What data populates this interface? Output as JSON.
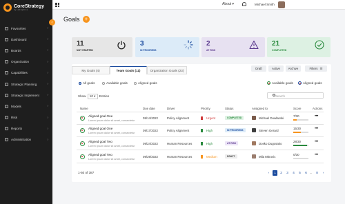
{
  "app": {
    "logo_name": "CoreStrategy",
    "logo_sub": "by adaptive"
  },
  "sidebar": {
    "items": [
      {
        "label": "Favourites"
      },
      {
        "label": "Dashboard"
      },
      {
        "label": "Boards"
      },
      {
        "label": "Organization"
      },
      {
        "label": "Capabilities"
      },
      {
        "label": "Strategic Planning"
      },
      {
        "label": "Strategic Implement"
      },
      {
        "label": "Models"
      },
      {
        "label": "Risk"
      },
      {
        "label": "Reports"
      },
      {
        "label": "Administration"
      }
    ]
  },
  "topbar": {
    "about": "About ▾",
    "user": "Michael Smith"
  },
  "page": {
    "title": "Goals",
    "add_label": "+"
  },
  "stats": [
    {
      "value": "11",
      "label": "NOT STARTED",
      "icon": "power-icon",
      "bg": "#e6e6e6",
      "color": "#222222"
    },
    {
      "value": "3",
      "label": "IN PROGRESS",
      "icon": "spinner-icon",
      "bg": "#dcebf8",
      "color": "#1a4a9e"
    },
    {
      "value": "2",
      "label": "AT RISK",
      "icon": "warning-icon",
      "bg": "#e7e1f1",
      "color": "#5b3a8e"
    },
    {
      "value": "21",
      "label": "COMPLETED",
      "icon": "check-circle-icon",
      "bg": "#ddf1e3",
      "color": "#2a8a3e"
    }
  ],
  "tabs": {
    "my": "My Goals (4)",
    "team": "Team Goals (11)",
    "org": "Organization Goals (23)"
  },
  "filters": {
    "draft": "Draft",
    "active": "Active",
    "archive": "Archive",
    "filters": "Filters"
  },
  "radios": {
    "all": "All goals",
    "available": "Available goals",
    "aligned": "Aligned goals"
  },
  "legend": {
    "available": "Available goals",
    "aligned": "Aligned goals"
  },
  "entries": {
    "show": "Show",
    "count": "10",
    "suffix": "Entries"
  },
  "search": {
    "placeholder": "Search"
  },
  "table": {
    "headers": {
      "name": "Name",
      "due": "Due date",
      "driver": "Driver",
      "priority": "Priority",
      "status": "Status",
      "assigned": "Assigned to",
      "score": "Score",
      "actions": "Actions"
    },
    "rows": [
      {
        "title": "Aligned goal One",
        "sub": "Lorem ipsum dolor sit amet, consectetur",
        "due": "09/14/2022",
        "driver": "Policy Alignment",
        "priority": "Urgent",
        "prio_color": "#d03b3b",
        "status": "COMPLETED",
        "status_bg": "#dff2e4",
        "status_color": "#2a8a3e",
        "assignee": "Michael Dowlanski",
        "score": "7/30",
        "fill": 0.23,
        "bar_color": "#f7941d",
        "av": "#7a5b4a"
      },
      {
        "title": "Aligned goal One",
        "sub": "Lorem ipsum dolor sit amet, consectetur",
        "due": "09/17/2022",
        "driver": "Policy Alignment",
        "priority": "High",
        "prio_color": "#2a8a3e",
        "status": "IN PROGRESS",
        "status_bg": "#dcebf8",
        "status_color": "#1a4a9e",
        "assignee": "Steven Gerard",
        "score": "15/30",
        "fill": 0.5,
        "bar_color": "#f7941d",
        "av": "#3e3e3e"
      },
      {
        "title": "Aligned goal Two",
        "sub": "Lorem ipsum dolor sit amet, consectetur",
        "due": "09/24/2022",
        "driver": "Human Resources",
        "priority": "High",
        "prio_color": "#2a8a3e",
        "status": "AT RISK",
        "status_bg": "#ece4f7",
        "status_color": "#5b3a8e",
        "assignee": "Dosko Dugosako",
        "score": "28/30",
        "fill": 0.93,
        "bar_color": "#2a8a3e",
        "av": "#a07860"
      },
      {
        "title": "Aligned goal Two",
        "sub": "Lorem ipsum dolor sit amet, consectetur",
        "due": "09/29/2022",
        "driver": "Human Resources",
        "priority": "Medium",
        "prio_color": "#f7941d",
        "status": "DRAFT",
        "status_bg": "#ececec",
        "status_color": "#444444",
        "assignee": "Mila Mitrovic",
        "score": "0/30",
        "fill": 0,
        "bar_color": "#f7941d",
        "av": "#9b7d6e"
      }
    ]
  },
  "pagination": {
    "range": "1-50 of 387",
    "pages": [
      "‹",
      "1",
      "2",
      "3",
      "4",
      "5",
      "6",
      "...",
      "8",
      "›"
    ]
  }
}
